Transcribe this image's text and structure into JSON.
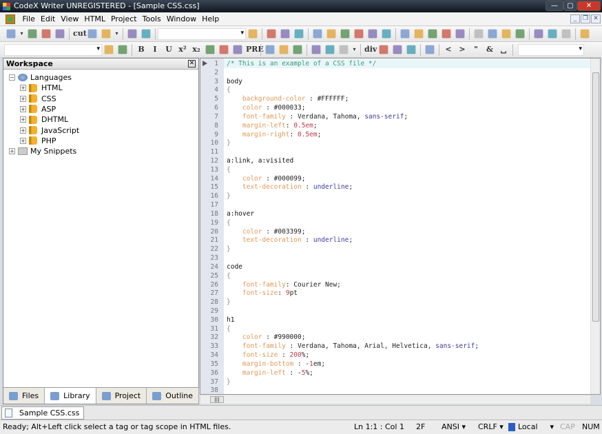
{
  "window": {
    "title": "CodeX Writer UNREGISTERED - [Sample CSS.css]",
    "minimize": "—",
    "maximize": "▢",
    "close": "✕"
  },
  "menu": [
    "File",
    "Edit",
    "View",
    "HTML",
    "Project",
    "Tools",
    "Window",
    "Help"
  ],
  "mdi_buttons": [
    "_",
    "❐",
    "✕"
  ],
  "toolbar1_icons": [
    "new-file",
    "dropdown",
    "open-folder",
    "save",
    "save-all",
    "|",
    "cut",
    "copy",
    "paste",
    "dropdown",
    "|",
    "undo",
    "redo",
    "|",
    "COMBO",
    "find",
    "|",
    "format",
    "list-view",
    "font-style",
    "|",
    "view-design",
    "view-preview",
    "view-web",
    "view-split",
    "view-cascade",
    "properties",
    "|",
    "browser-preview",
    "internet-explorer",
    "firefox",
    "opera",
    "chrome",
    "|",
    "table",
    "indent-right",
    "indent-left",
    "outdent",
    "|",
    "ordered-list",
    "bullet-list",
    "definition-list",
    "|",
    "outline"
  ],
  "toolbar2_icons": [
    "COMBO2",
    "cdata",
    "css-block",
    "|",
    "B",
    "I",
    "U",
    "x²",
    "x₂",
    "paragraph",
    "line-break",
    "form",
    "PRE",
    "|",
    "align-left",
    "align-center",
    "align-right",
    "|",
    "image",
    "image-map",
    "color-fill",
    "dropdown",
    "|",
    "div",
    "anchor",
    "network",
    "server",
    "|",
    "frame",
    "|",
    "<",
    ">",
    "\"",
    "&",
    "␣",
    "|",
    "COMBO3"
  ],
  "workspace": {
    "title": "Workspace",
    "close": "✕",
    "tree": [
      {
        "label": "Languages",
        "level": 0,
        "expander": "−",
        "icon": "globe"
      },
      {
        "label": "HTML",
        "level": 1,
        "expander": "+",
        "icon": "book"
      },
      {
        "label": "CSS",
        "level": 1,
        "expander": "+",
        "icon": "book"
      },
      {
        "label": "ASP",
        "level": 1,
        "expander": "+",
        "icon": "book"
      },
      {
        "label": "DHTML",
        "level": 1,
        "expander": "+",
        "icon": "book"
      },
      {
        "label": "JavaScript",
        "level": 1,
        "expander": "+",
        "icon": "book"
      },
      {
        "label": "PHP",
        "level": 1,
        "expander": "+",
        "icon": "book"
      },
      {
        "label": "My Snippets",
        "level": 0,
        "expander": "+",
        "icon": "folder"
      }
    ],
    "tabs": [
      "Files",
      "Library",
      "Project",
      "Outline"
    ],
    "active_tab": "Library"
  },
  "editor": {
    "colors": {
      "comment": "#3a9a72",
      "property": "#e09a58",
      "keyword": "#3b3b9e",
      "number": "#c03848"
    },
    "lines": [
      [
        [
          "c",
          "/* This is an example of a CSS file */"
        ]
      ],
      [],
      [
        [
          "s",
          "body"
        ]
      ],
      [
        [
          "b",
          "{"
        ]
      ],
      [
        [
          "v",
          "    "
        ],
        [
          "p",
          "background-color"
        ],
        [
          "v",
          " : #FFFFFF;"
        ]
      ],
      [
        [
          "v",
          "    "
        ],
        [
          "p",
          "color"
        ],
        [
          "v",
          " : #000033;"
        ]
      ],
      [
        [
          "v",
          "    "
        ],
        [
          "p",
          "font-family"
        ],
        [
          "v",
          " : Verdana, Tahoma, "
        ],
        [
          "k",
          "sans-serif"
        ],
        [
          "v",
          ";"
        ]
      ],
      [
        [
          "v",
          "    "
        ],
        [
          "p",
          "margin-left"
        ],
        [
          "v",
          ": "
        ],
        [
          "n",
          "0.5em"
        ],
        [
          "v",
          ";"
        ]
      ],
      [
        [
          "v",
          "    "
        ],
        [
          "p",
          "margin-right"
        ],
        [
          "v",
          ": "
        ],
        [
          "n",
          "0.5em"
        ],
        [
          "v",
          ";"
        ]
      ],
      [
        [
          "b",
          "}"
        ]
      ],
      [],
      [
        [
          "s",
          "a:link, a:visited"
        ]
      ],
      [
        [
          "b",
          "{"
        ]
      ],
      [
        [
          "v",
          "    "
        ],
        [
          "p",
          "color"
        ],
        [
          "v",
          " : #000099;"
        ]
      ],
      [
        [
          "v",
          "    "
        ],
        [
          "p",
          "text-decoration"
        ],
        [
          "v",
          " : "
        ],
        [
          "k",
          "underline"
        ],
        [
          "v",
          ";"
        ]
      ],
      [
        [
          "b",
          "}"
        ]
      ],
      [],
      [
        [
          "s",
          "a:hover"
        ]
      ],
      [
        [
          "b",
          "{"
        ]
      ],
      [
        [
          "v",
          "    "
        ],
        [
          "p",
          "color"
        ],
        [
          "v",
          " : #003399;"
        ]
      ],
      [
        [
          "v",
          "    "
        ],
        [
          "p",
          "text-decoration"
        ],
        [
          "v",
          " : "
        ],
        [
          "k",
          "underline"
        ],
        [
          "v",
          ";"
        ]
      ],
      [
        [
          "b",
          "}"
        ]
      ],
      [],
      [
        [
          "s",
          "code"
        ]
      ],
      [
        [
          "b",
          "{"
        ]
      ],
      [
        [
          "v",
          "    "
        ],
        [
          "p",
          "font-family"
        ],
        [
          "v",
          ": Courier New;"
        ]
      ],
      [
        [
          "v",
          "    "
        ],
        [
          "p",
          "font-size"
        ],
        [
          "v",
          ": "
        ],
        [
          "n",
          "9"
        ],
        [
          "v",
          "pt"
        ]
      ],
      [
        [
          "b",
          "}"
        ]
      ],
      [],
      [
        [
          "s",
          "h1"
        ]
      ],
      [
        [
          "b",
          "{"
        ]
      ],
      [
        [
          "v",
          "    "
        ],
        [
          "p",
          "color"
        ],
        [
          "v",
          " : #990000;"
        ]
      ],
      [
        [
          "v",
          "    "
        ],
        [
          "p",
          "font-family"
        ],
        [
          "v",
          " : Verdana, Tahoma, Arial, Helvetica, "
        ],
        [
          "k",
          "sans-serif"
        ],
        [
          "v",
          ";"
        ]
      ],
      [
        [
          "v",
          "    "
        ],
        [
          "p",
          "font-size"
        ],
        [
          "v",
          " : "
        ],
        [
          "n",
          "200"
        ],
        [
          "v",
          "%;"
        ]
      ],
      [
        [
          "v",
          "    "
        ],
        [
          "p",
          "margin-bottom"
        ],
        [
          "v",
          " : -"
        ],
        [
          "n",
          "1"
        ],
        [
          "v",
          "em;"
        ]
      ],
      [
        [
          "v",
          "    "
        ],
        [
          "p",
          "margin-left"
        ],
        [
          "v",
          " : -"
        ],
        [
          "n",
          "5"
        ],
        [
          "v",
          "%;"
        ]
      ],
      [
        [
          "b",
          "}"
        ]
      ],
      []
    ]
  },
  "doc_tab": "Sample CSS.css",
  "status": {
    "message": "Ready; Alt+Left click select a tag or tag scope in HTML files.",
    "position": "Ln 1:1 : Col 1",
    "char": "2F",
    "encoding": "ANSI",
    "line_ending": "CRLF",
    "location": "Local",
    "cap": "CAP",
    "num": "NUM"
  }
}
